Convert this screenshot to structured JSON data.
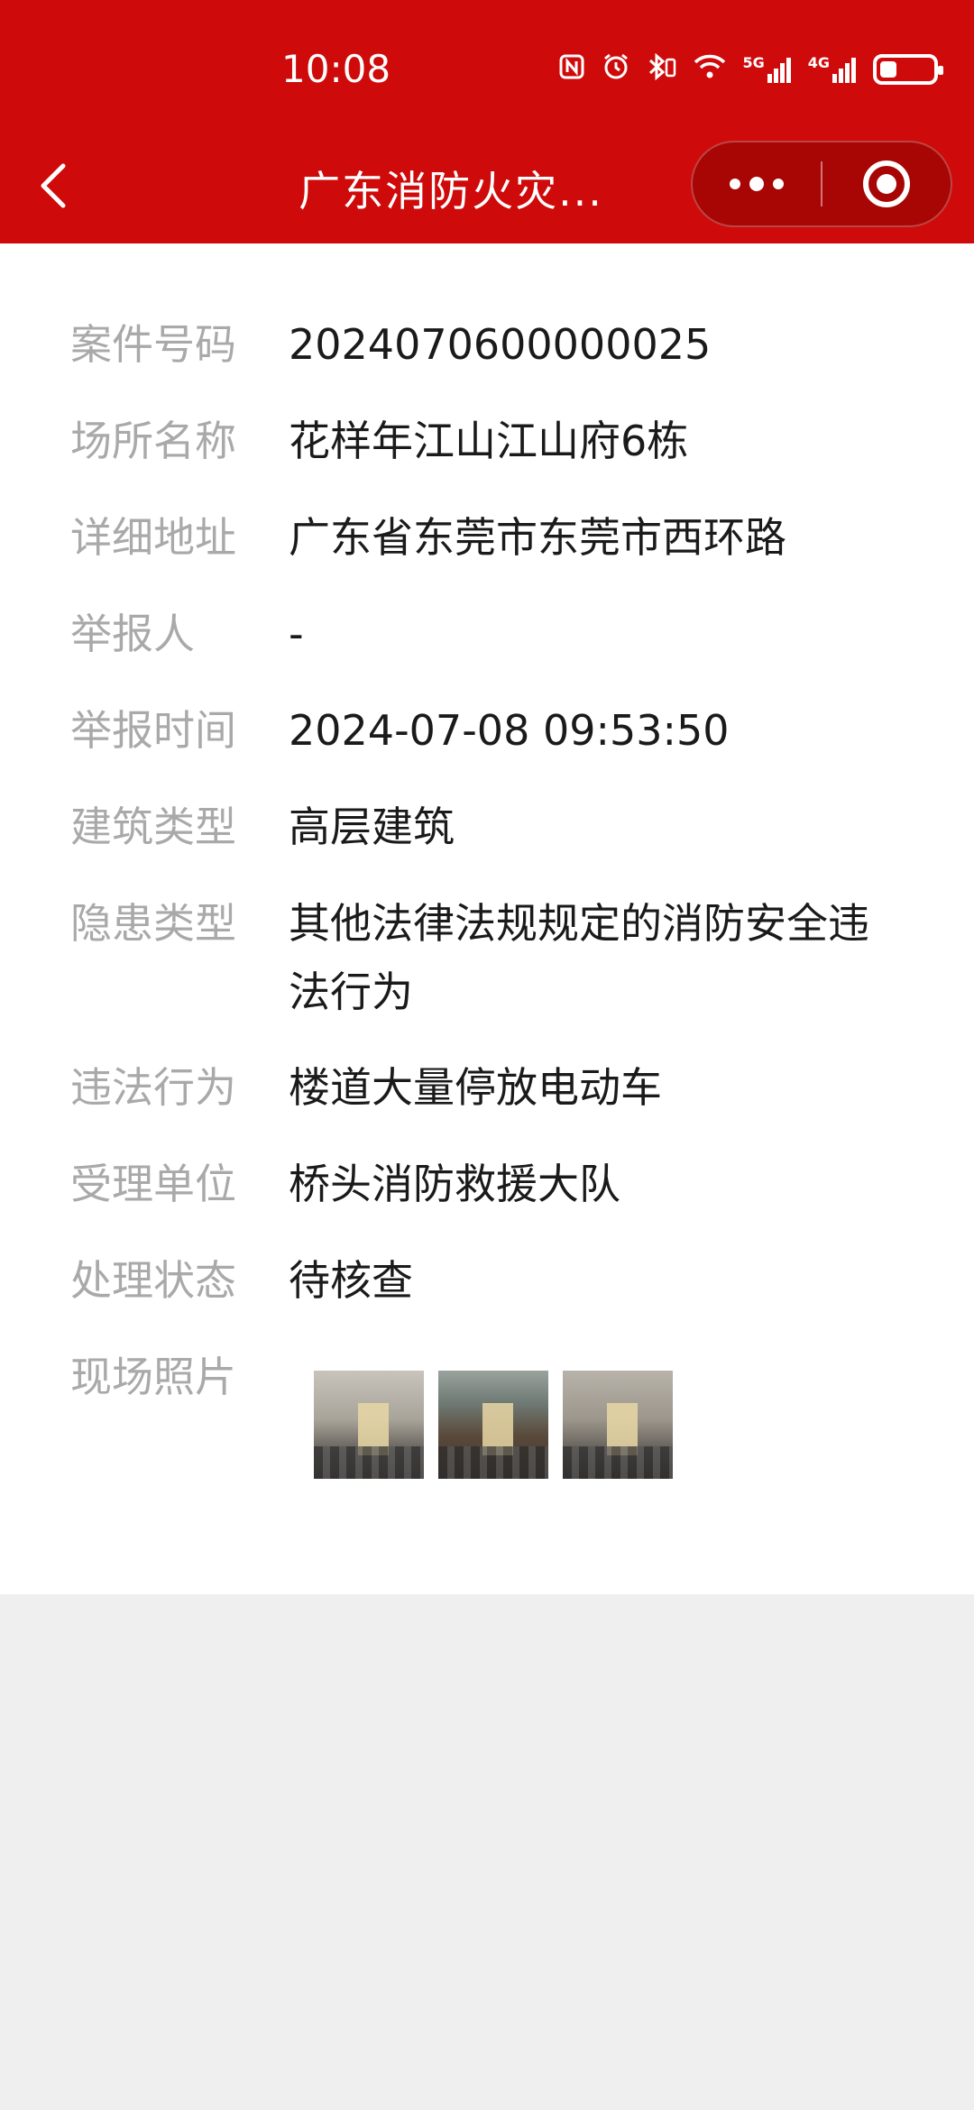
{
  "status_bar": {
    "time": "10:08",
    "icons": [
      "nfc-icon",
      "alarm-icon",
      "bluetooth-icon",
      "wifi-icon",
      "5g-signal-icon",
      "4g-signal-icon",
      "battery-icon"
    ],
    "signal_5g": "5G",
    "signal_4g": "4G",
    "battery_level": 0.3
  },
  "nav": {
    "title": "广东消防火灾..."
  },
  "colors": {
    "header_bg": "#cf0a0a",
    "label": "#a9a9a9",
    "value": "#1a1a1a",
    "page_bg": "#efefef"
  },
  "details": [
    {
      "label": "案件号码",
      "value": "2024070600000025"
    },
    {
      "label": "场所名称",
      "value": "花样年江山江山府6栋"
    },
    {
      "label": "详细地址",
      "value": "广东省东莞市东莞市西环路"
    },
    {
      "label": "举报人",
      "value": "-"
    },
    {
      "label": "举报时间",
      "value": "2024-07-08 09:53:50"
    },
    {
      "label": "建筑类型",
      "value": "高层建筑"
    },
    {
      "label": "隐患类型",
      "value": "其他法律法规规定的消防安全违法行为"
    },
    {
      "label": "违法行为",
      "value": "楼道大量停放电动车"
    },
    {
      "label": "受理单位",
      "value": "桥头消防救援大队"
    },
    {
      "label": "处理状态",
      "value": "待核查"
    },
    {
      "label": "现场照片",
      "value": ""
    }
  ],
  "photos_count": 3
}
